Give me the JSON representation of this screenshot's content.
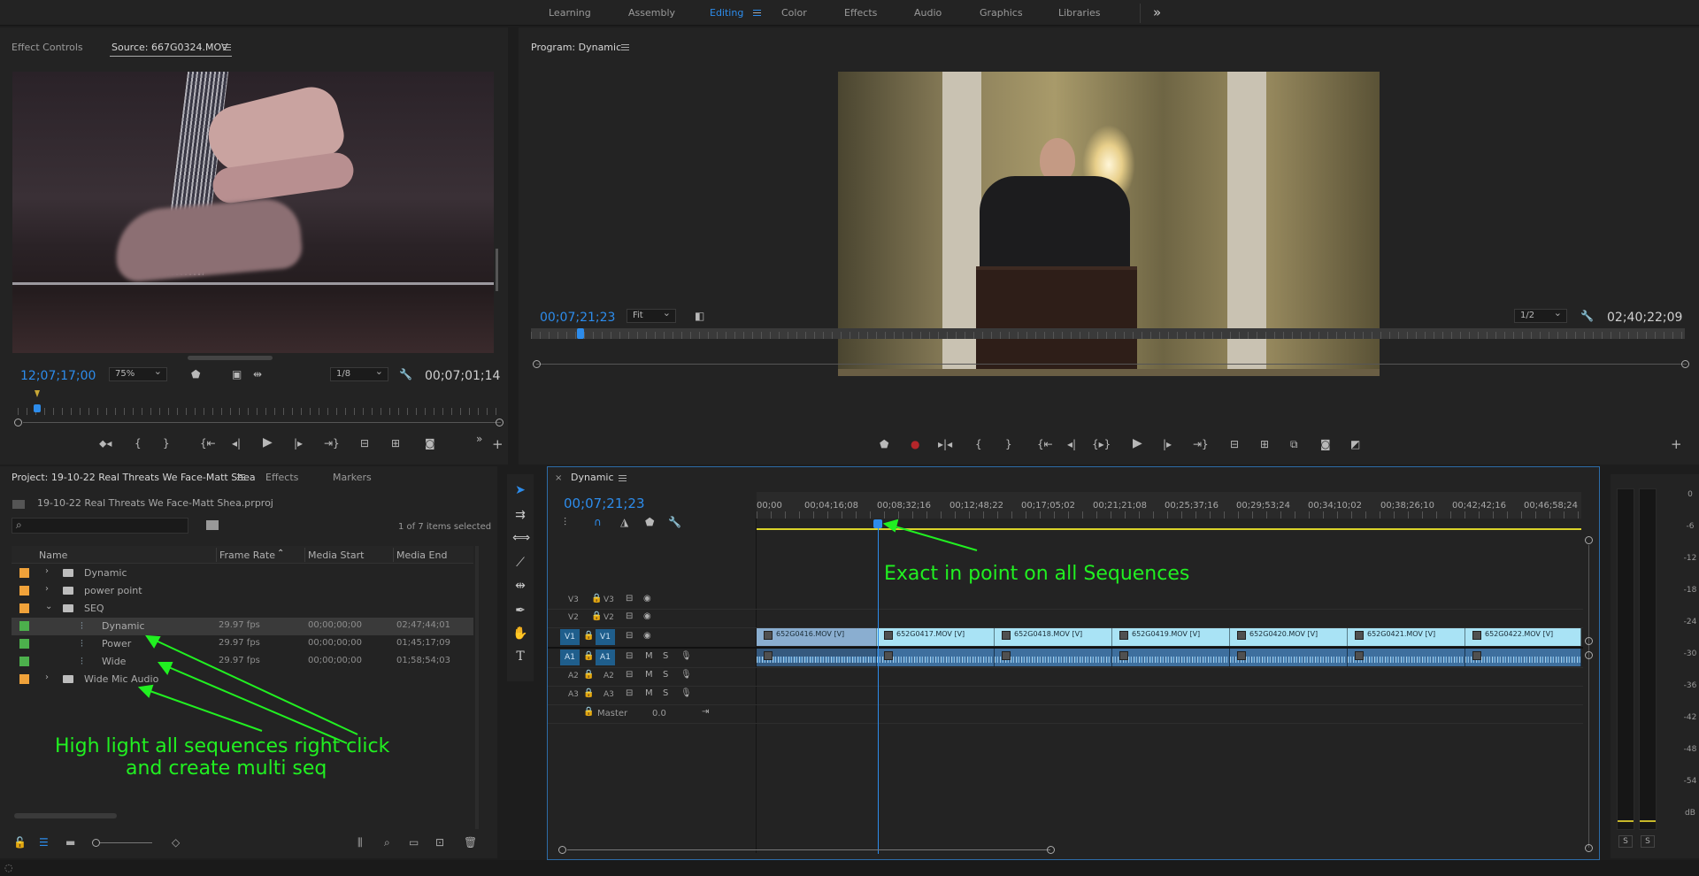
{
  "workspaces": {
    "items": [
      "Learning",
      "Assembly",
      "Editing",
      "Color",
      "Effects",
      "Audio",
      "Graphics",
      "Libraries"
    ],
    "active": "Editing",
    "more": "»"
  },
  "source_panel": {
    "tab_effect_controls": "Effect Controls",
    "tab_source": "Source: 667G0324.MOV",
    "playhead_tc": "12;07;17;00",
    "zoom": "75%",
    "resolution": "1/8",
    "duration_tc": "00;07;01;14"
  },
  "program_panel": {
    "title": "Program: Dynamic",
    "playhead_tc": "00;07;21;23",
    "fit": "Fit",
    "resolution": "1/2",
    "duration_tc": "02;40;22;09"
  },
  "project_panel": {
    "tab_project": "Project: 19-10-22 Real Threats We Face-Matt Shea",
    "tab_effects": "Effects",
    "tab_markers": "Markers",
    "file_name": "19-10-22 Real Threats We Face-Matt Shea.prproj",
    "selection_count": "1 of 7 items selected",
    "columns": [
      "Name",
      "Frame Rate",
      "Media Start",
      "Media End"
    ],
    "rows": [
      {
        "type": "folder",
        "name": "Dynamic",
        "color": "#f0a23a",
        "expand": "›",
        "frame_rate": "",
        "media_start": "",
        "media_end": ""
      },
      {
        "type": "folder",
        "name": "power point",
        "color": "#f0a23a",
        "expand": "›",
        "frame_rate": "",
        "media_start": "",
        "media_end": ""
      },
      {
        "type": "folder",
        "name": "SEQ",
        "color": "#f0a23a",
        "expand": "⌄",
        "frame_rate": "",
        "media_start": "",
        "media_end": ""
      },
      {
        "type": "sequence",
        "name": "Dynamic",
        "color": "#4cb04c",
        "frame_rate": "29.97 fps",
        "media_start": "00;00;00;00",
        "media_end": "02;47;44;01"
      },
      {
        "type": "sequence",
        "name": "Power",
        "color": "#4cb04c",
        "frame_rate": "29.97 fps",
        "media_start": "00;00;00;00",
        "media_end": "01;45;17;09"
      },
      {
        "type": "sequence",
        "name": "Wide",
        "color": "#4cb04c",
        "frame_rate": "29.97 fps",
        "media_start": "00;00;00;00",
        "media_end": "01;58;54;03"
      },
      {
        "type": "folder",
        "name": "Wide Mic Audio",
        "color": "#f0a23a",
        "expand": "›",
        "frame_rate": "",
        "media_start": "",
        "media_end": ""
      }
    ]
  },
  "timeline": {
    "tab": "Dynamic",
    "playhead_tc": "00;07;21;23",
    "ruler": [
      "00;00",
      "00;04;16;08",
      "00;08;32;16",
      "00;12;48;22",
      "00;17;05;02",
      "00;21;21;08",
      "00;25;37;16",
      "00;29;53;24",
      "00;34;10;02",
      "00;38;26;10",
      "00;42;42;16",
      "00;46;58;24"
    ],
    "tracks_video": [
      "V3",
      "V2",
      "V1"
    ],
    "tracks_audio": [
      "A1",
      "A2",
      "A3"
    ],
    "mute": "M",
    "solo": "S",
    "master_label": "Master",
    "master_value": "0.0",
    "video_clips": [
      "652G0416.MOV [V]",
      "652G0417.MOV [V]",
      "652G0418.MOV [V]",
      "652G0419.MOV [V]",
      "652G0420.MOV [V]",
      "652G0421.MOV [V]",
      "652G0422.MOV [V]"
    ]
  },
  "meter": {
    "scale": [
      "0",
      "-6",
      "-12",
      "-18",
      "-24",
      "-30",
      "-36",
      "-42",
      "-48",
      "-54",
      "dB"
    ],
    "solo_buttons": [
      "S",
      "S"
    ]
  },
  "annotations": {
    "in_point": "Exact in point on all Sequences",
    "multi_seq_line1": "High light all sequences right click",
    "multi_seq_line2": "and create multi seq"
  }
}
